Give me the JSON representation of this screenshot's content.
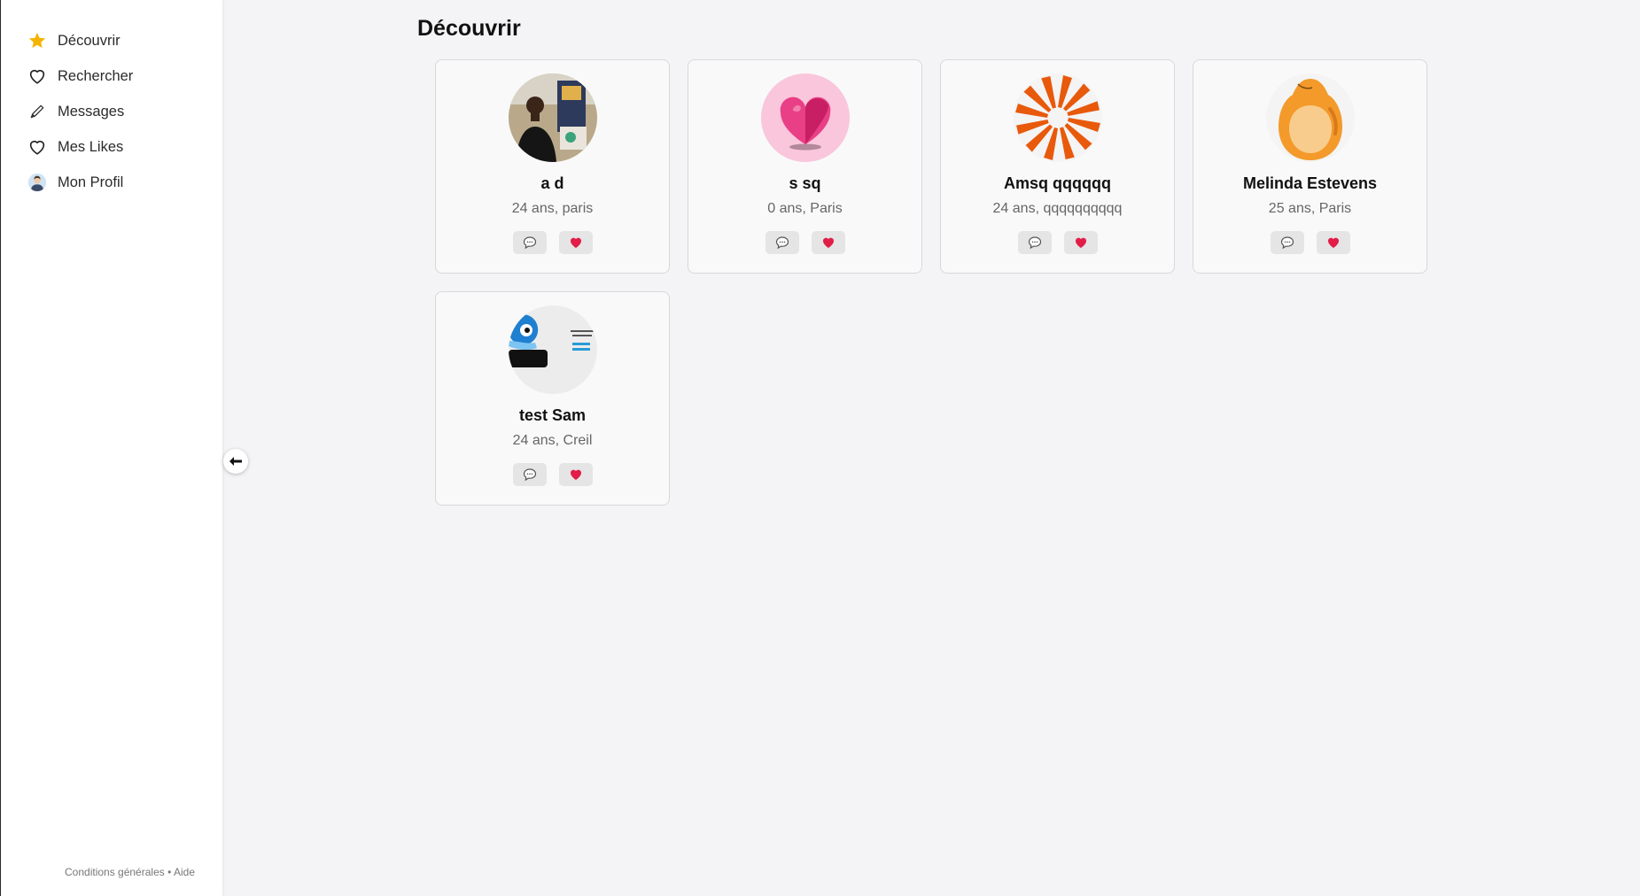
{
  "sidebar": {
    "items": [
      {
        "label": "Découvrir",
        "icon": "star-icon"
      },
      {
        "label": "Rechercher",
        "icon": "heart-outline-icon"
      },
      {
        "label": "Messages",
        "icon": "pen-icon"
      },
      {
        "label": "Mes Likes",
        "icon": "heart-outline-icon"
      },
      {
        "label": "Mon Profil",
        "icon": "profile-avatar-icon"
      }
    ],
    "footer": {
      "terms": "Conditions générales",
      "separator": "•",
      "help": "Aide"
    }
  },
  "toggle": {
    "icon": "arrow-left-icon"
  },
  "main": {
    "title": "Découvrir",
    "profiles": [
      {
        "name": "a d",
        "meta": "24 ans, paris",
        "avatar": "photo-avatar"
      },
      {
        "name": "s sq",
        "meta": "0 ans, Paris",
        "avatar": "pink-heart-avatar"
      },
      {
        "name": "Amsq qqqqqq",
        "meta": "24 ans, qqqqqqqqqq",
        "avatar": "orange-swirl-avatar"
      },
      {
        "name": "Melinda Estevens",
        "meta": "25 ans, Paris",
        "avatar": "orange-blob-avatar"
      },
      {
        "name": "test Sam",
        "meta": "24 ans, Creil",
        "avatar": "weet-logo-avatar"
      }
    ]
  },
  "colors": {
    "star": "#f5b301",
    "heart": "#e11d48",
    "background": "#f4f4f6"
  }
}
